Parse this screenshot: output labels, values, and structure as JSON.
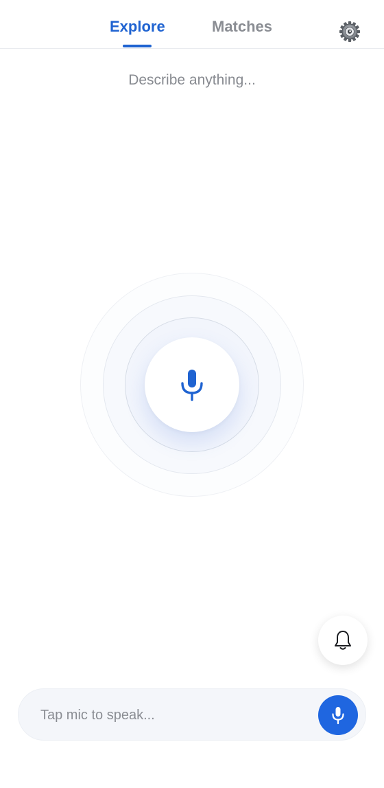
{
  "header": {
    "tabs": [
      {
        "label": "Explore",
        "active": true
      },
      {
        "label": "Matches",
        "active": false
      }
    ],
    "settings_icon": "gear-icon"
  },
  "main": {
    "prompt": "Describe anything...",
    "center_icon": "microphone-icon"
  },
  "notifications": {
    "icon": "bell-icon"
  },
  "input": {
    "placeholder": "Tap mic to speak...",
    "value": "",
    "button_icon": "microphone-icon"
  },
  "colors": {
    "accent": "#1f63d1",
    "button": "#1f66e0",
    "muted_text": "#878a90"
  }
}
